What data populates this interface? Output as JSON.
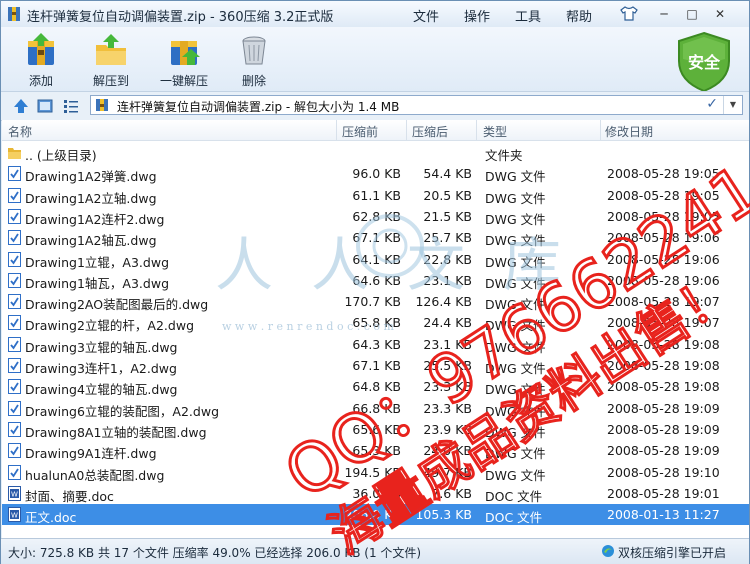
{
  "window": {
    "title": "连杆弹簧复位自动调偏装置.zip - 360压缩 3.2正式版",
    "menu": [
      "文件",
      "操作",
      "工具",
      "帮助"
    ],
    "controls": [
      "─",
      "□",
      "✕"
    ]
  },
  "toolbar": {
    "buttons": [
      {
        "label": "添加",
        "icon": "add-archive-icon"
      },
      {
        "label": "解压到",
        "icon": "extract-folder-icon"
      },
      {
        "label": "一键解压",
        "icon": "one-click-extract-icon"
      },
      {
        "label": "删除",
        "icon": "delete-bin-icon"
      }
    ],
    "security_badge": "安全"
  },
  "address": {
    "path": "连杆弹簧复位自动调偏装置.zip - 解包大小为 1.4 MB"
  },
  "columns": [
    "名称",
    "压缩前",
    "压缩后",
    "类型",
    "修改日期"
  ],
  "files": [
    {
      "name": ".. (上级目录)",
      "size": "",
      "packed": "",
      "type": "文件夹",
      "date": "",
      "kind": "folder"
    },
    {
      "name": "Drawing1A2弹簧.dwg",
      "size": "96.0 KB",
      "packed": "54.4 KB",
      "type": "DWG 文件",
      "date": "2008-05-28 19:05",
      "kind": "dwg"
    },
    {
      "name": "Drawing1A2立轴.dwg",
      "size": "61.1 KB",
      "packed": "20.5 KB",
      "type": "DWG 文件",
      "date": "2008-05-28 19:05",
      "kind": "dwg"
    },
    {
      "name": "Drawing1A2连杆2.dwg",
      "size": "62.8 KB",
      "packed": "21.5 KB",
      "type": "DWG 文件",
      "date": "2008-05-28 19:05",
      "kind": "dwg"
    },
    {
      "name": "Drawing1A2轴瓦.dwg",
      "size": "67.1 KB",
      "packed": "25.7 KB",
      "type": "DWG 文件",
      "date": "2008-05-28 19:06",
      "kind": "dwg"
    },
    {
      "name": "Drawing1立辊，A3.dwg",
      "size": "64.1 KB",
      "packed": "22.8 KB",
      "type": "DWG 文件",
      "date": "2008-05-28 19:06",
      "kind": "dwg"
    },
    {
      "name": "Drawing1轴瓦，A3.dwg",
      "size": "64.6 KB",
      "packed": "23.1 KB",
      "type": "DWG 文件",
      "date": "2008-05-28 19:06",
      "kind": "dwg"
    },
    {
      "name": "Drawing2AO装配图最后的.dwg",
      "size": "170.7 KB",
      "packed": "126.4 KB",
      "type": "DWG 文件",
      "date": "2008-05-28 19:07",
      "kind": "dwg"
    },
    {
      "name": "Drawing2立辊的杆，A2.dwg",
      "size": "65.8 KB",
      "packed": "24.4 KB",
      "type": "DWG 文件",
      "date": "2008-05-28 19:07",
      "kind": "dwg"
    },
    {
      "name": "Drawing3立辊的轴瓦.dwg",
      "size": "64.3 KB",
      "packed": "23.1 KB",
      "type": "DWG 文件",
      "date": "2008-05-28 19:08",
      "kind": "dwg"
    },
    {
      "name": "Drawing3连杆1，A2.dwg",
      "size": "67.1 KB",
      "packed": "25.5 KB",
      "type": "DWG 文件",
      "date": "2008-05-28 19:08",
      "kind": "dwg"
    },
    {
      "name": "Drawing4立辊的轴瓦.dwg",
      "size": "64.8 KB",
      "packed": "23.3 KB",
      "type": "DWG 文件",
      "date": "2008-05-28 19:08",
      "kind": "dwg"
    },
    {
      "name": "Drawing6立辊的装配图，A2.dwg",
      "size": "66.8 KB",
      "packed": "23.3 KB",
      "type": "DWG 文件",
      "date": "2008-05-28 19:09",
      "kind": "dwg"
    },
    {
      "name": "Drawing8A1立轴的装配图.dwg",
      "size": "65.6 KB",
      "packed": "23.9 KB",
      "type": "DWG 文件",
      "date": "2008-05-28 19:09",
      "kind": "dwg"
    },
    {
      "name": "Drawing9A1连杆.dwg",
      "size": "65.3 KB",
      "packed": "24.0 KB",
      "type": "DWG 文件",
      "date": "2008-05-28 19:09",
      "kind": "dwg"
    },
    {
      "name": "hualunA0总装配图.dwg",
      "size": "194.5 KB",
      "packed": "49.7 KB",
      "type": "DWG 文件",
      "date": "2008-05-28 19:10",
      "kind": "dwg"
    },
    {
      "name": "封面、摘要.doc",
      "size": "36.0 KB",
      "packed": "7.6 KB",
      "type": "DOC 文件",
      "date": "2008-05-28 19:01",
      "kind": "doc"
    },
    {
      "name": "正文.doc",
      "size": "206.0 KB",
      "packed": "105.3 KB",
      "type": "DOC 文件",
      "date": "2008-01-13 11:27",
      "kind": "doc",
      "selected": true
    }
  ],
  "status": {
    "summary": "大小: 725.8 KB 共 17 个文件 压缩率 49.0% 已经选择 206.0 KB (1 个文件)",
    "engine": "双核压缩引擎已开启"
  },
  "watermark": {
    "site_cn": "人人文库",
    "site_url": "w w w . r e n r e n d o c . c o m",
    "qq_line": "QQ：976662241",
    "promo_line": "海量成品资料出售！"
  },
  "colors": {
    "selection": "#3d8ee6",
    "watermark_red": "#e8231d",
    "watermark_blue": "#9dc4de",
    "shield_green": "#5db13a"
  }
}
